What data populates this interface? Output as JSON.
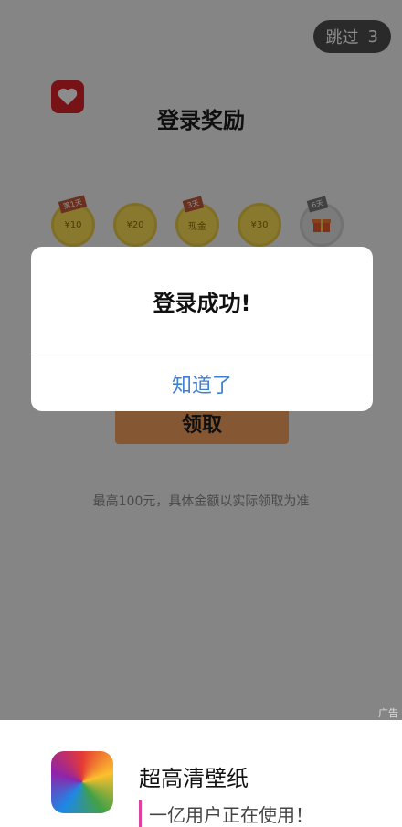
{
  "skip": {
    "label": "跳过",
    "countdown": "3"
  },
  "title": "登录奖励",
  "coins": [
    {
      "tag": "第1天",
      "value": "¥10"
    },
    {
      "tag": "",
      "value": "¥20"
    },
    {
      "tag": "3天",
      "value": "现金"
    },
    {
      "tag": "",
      "value": "¥30"
    },
    {
      "tag": "6天",
      "value": ""
    }
  ],
  "claim_button": "领取",
  "note": "最高100元，具体金额以实际领取为准",
  "dialog": {
    "message": "登录成功!",
    "button": "知道了"
  },
  "ad_mark": "广告",
  "promo": {
    "app_name": "超高清壁纸",
    "subtitle": "一亿用户正在使用！"
  }
}
